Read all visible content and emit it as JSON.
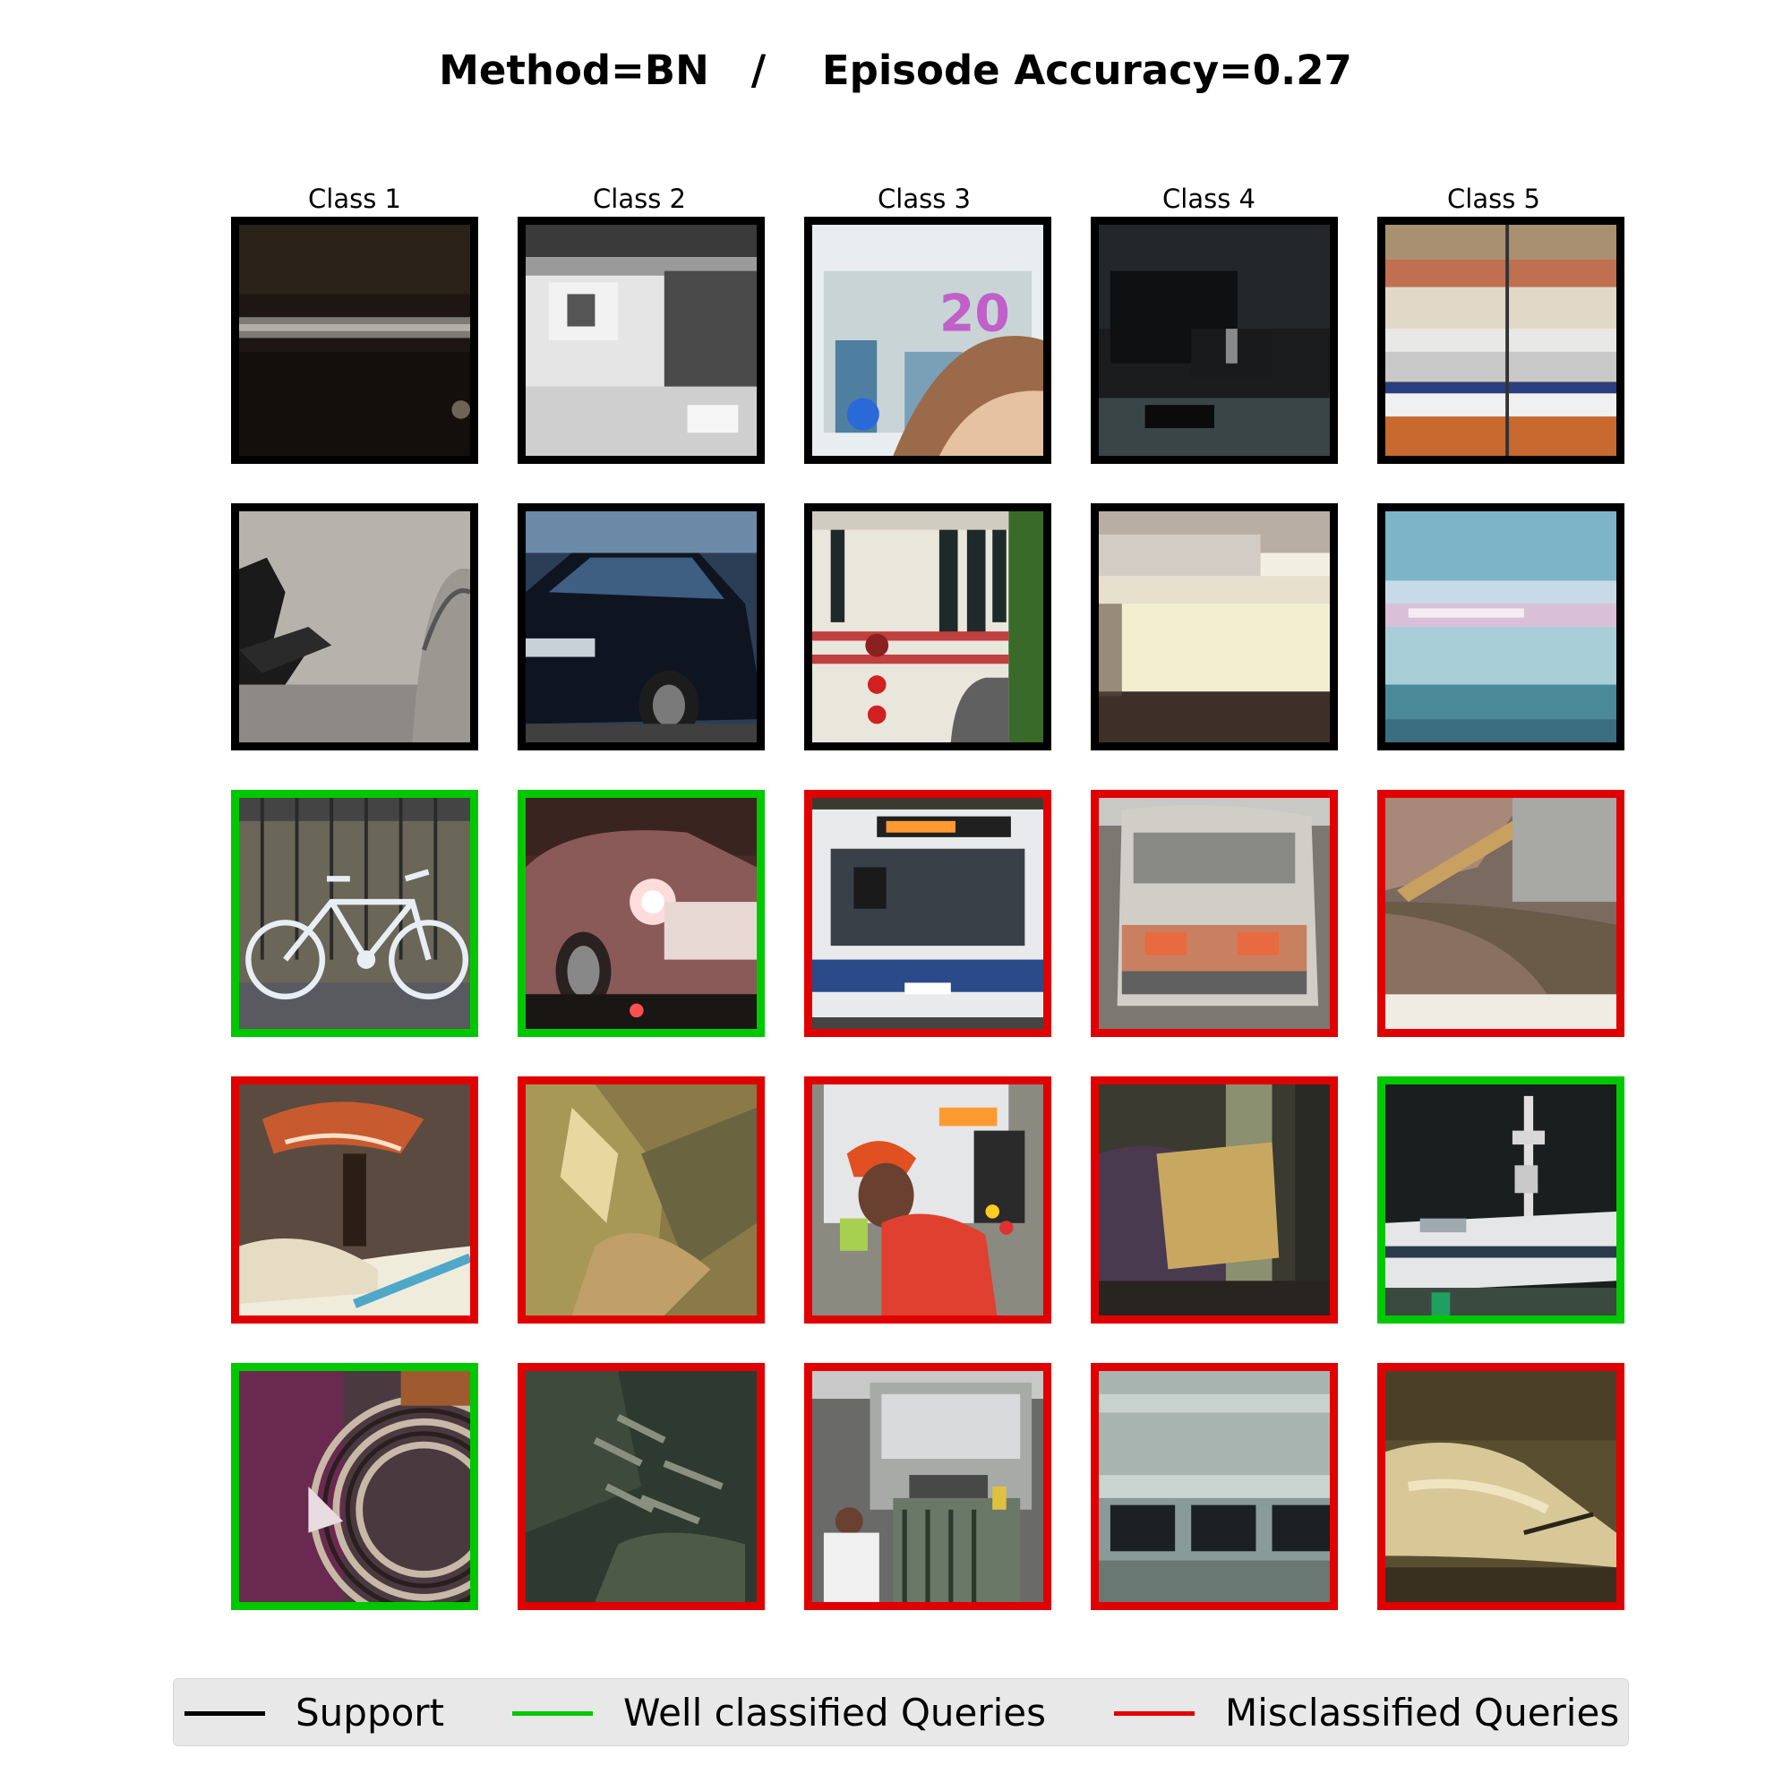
{
  "title": "Method=BN   /    Episode Accuracy=0.27",
  "columns": [
    "Class 1",
    "Class 2",
    "Class 3",
    "Class 4",
    "Class 5"
  ],
  "colors": {
    "support": "#000000",
    "well_classified": "#00c800",
    "misclassified": "#e00000",
    "legend_background": "#e8e8e8"
  },
  "grid": {
    "rows": [
      {
        "role": "support",
        "cells": [
          {
            "class": "Class 1",
            "status": "support",
            "content": "dark blurry crop"
          },
          {
            "class": "Class 2",
            "status": "support",
            "content": "grayscale vehicle"
          },
          {
            "class": "Class 3",
            "status": "support",
            "content": "person with headband"
          },
          {
            "class": "Class 4",
            "status": "support",
            "content": "black truck rear"
          },
          {
            "class": "Class 5",
            "status": "support",
            "content": "train platform"
          }
        ]
      },
      {
        "role": "support",
        "cells": [
          {
            "class": "Class 1",
            "status": "support",
            "content": "bicycle on gray wall"
          },
          {
            "class": "Class 2",
            "status": "support",
            "content": "black sedan"
          },
          {
            "class": "Class 3",
            "status": "support",
            "content": "white bus rear"
          },
          {
            "class": "Class 4",
            "status": "support",
            "content": "blurred cream vehicle"
          },
          {
            "class": "Class 5",
            "status": "support",
            "content": "blurred boat on water"
          }
        ]
      },
      {
        "role": "query",
        "cells": [
          {
            "class": "Class 1",
            "status": "well_classified",
            "content": "white bicycle"
          },
          {
            "class": "Class 2",
            "status": "well_classified",
            "content": "car tail lights"
          },
          {
            "class": "Class 3",
            "status": "misclassified",
            "content": "bus front"
          },
          {
            "class": "Class 4",
            "status": "misclassified",
            "content": "white van rear"
          },
          {
            "class": "Class 5",
            "status": "misclassified",
            "content": "wooden rowboat"
          }
        ]
      },
      {
        "role": "query",
        "cells": [
          {
            "class": "Class 1",
            "status": "misclassified",
            "content": "bicycle saddle"
          },
          {
            "class": "Class 2",
            "status": "misclassified",
            "content": "blurry olive crop"
          },
          {
            "class": "Class 3",
            "status": "misclassified",
            "content": "man in red cap near bus"
          },
          {
            "class": "Class 4",
            "status": "misclassified",
            "content": "blurred yellow vehicle"
          },
          {
            "class": "Class 5",
            "status": "well_classified",
            "content": "white ship"
          }
        ]
      },
      {
        "role": "query",
        "cells": [
          {
            "class": "Class 1",
            "status": "well_classified",
            "content": "wheel close-up"
          },
          {
            "class": "Class 2",
            "status": "misclassified",
            "content": "dark pixelated crop"
          },
          {
            "class": "Class 3",
            "status": "misclassified",
            "content": "tram with person"
          },
          {
            "class": "Class 4",
            "status": "misclassified",
            "content": "gray vehicle windows"
          },
          {
            "class": "Class 5",
            "status": "misclassified",
            "content": "blurred boat"
          }
        ]
      }
    ]
  },
  "legend": {
    "items": [
      {
        "key": "support",
        "label": "Support"
      },
      {
        "key": "well_classified",
        "label": "Well classified Queries"
      },
      {
        "key": "misclassified",
        "label": "Misclassified Queries"
      }
    ]
  }
}
